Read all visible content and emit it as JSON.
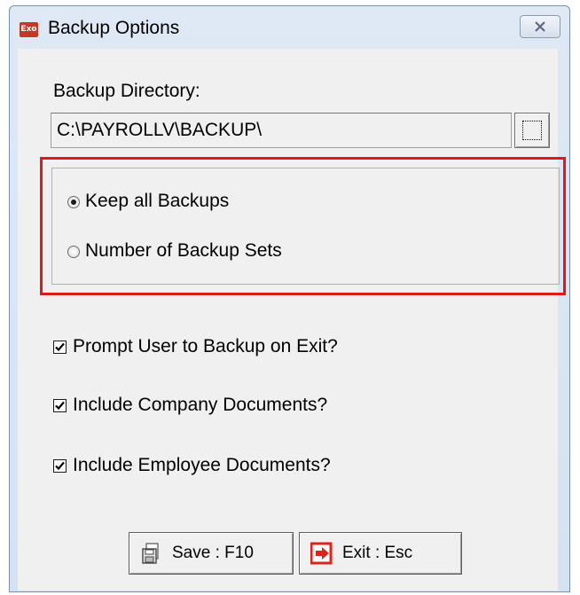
{
  "window": {
    "title": "Backup Options",
    "app_icon_text": "Exo"
  },
  "backup_directory": {
    "label": "Backup Directory:",
    "value": "C:\\PAYROLLV\\BACKUP\\"
  },
  "retention": {
    "options": [
      {
        "label": "Keep all Backups",
        "checked": true
      },
      {
        "label": "Number of Backup Sets",
        "checked": false
      }
    ]
  },
  "checkboxes": [
    {
      "label": "Prompt User to Backup on Exit?",
      "checked": true
    },
    {
      "label": "Include Company Documents?",
      "checked": true
    },
    {
      "label": "Include Employee Documents?",
      "checked": true
    }
  ],
  "buttons": {
    "save_label": "Save : F10",
    "exit_label": "Exit : Esc"
  },
  "colors": {
    "highlight": "#e3161c",
    "titlebar": "#dfe9f5",
    "exit_icon": "#d9261c"
  }
}
